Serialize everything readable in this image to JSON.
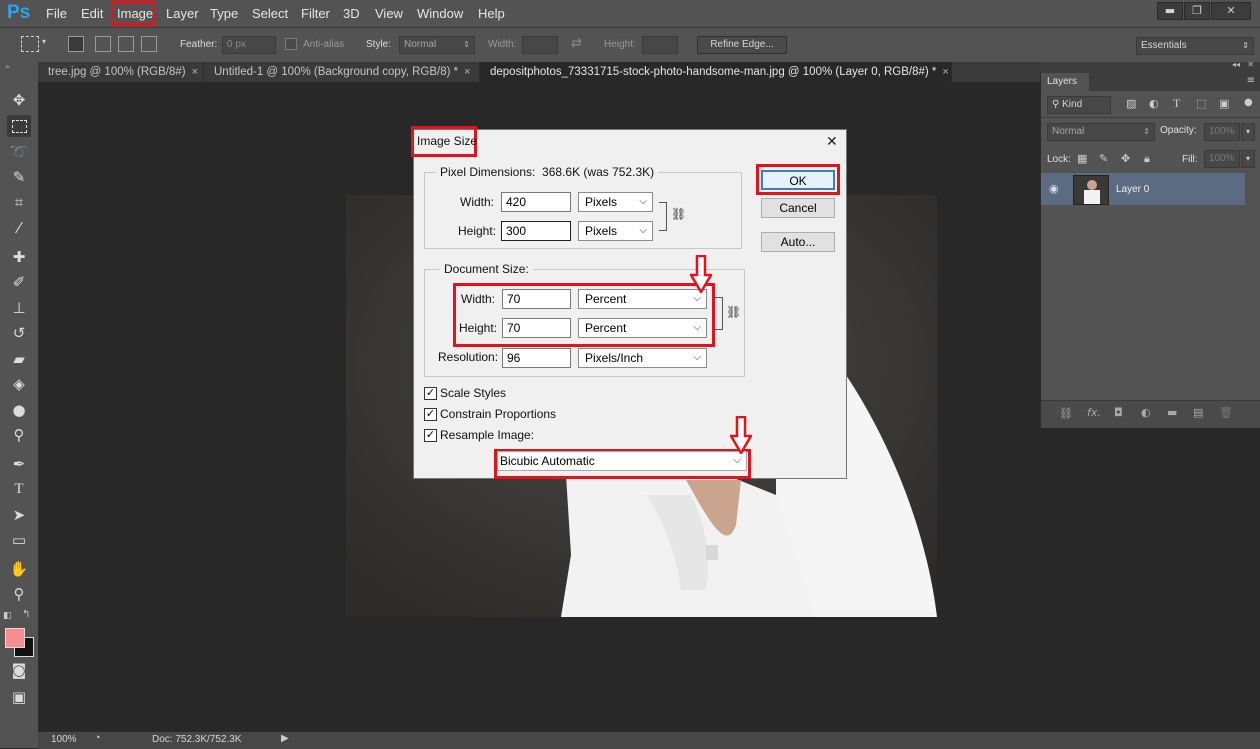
{
  "app": {
    "logo": "Ps"
  },
  "menu": [
    "File",
    "Edit",
    "Image",
    "Layer",
    "Type",
    "Select",
    "Filter",
    "3D",
    "View",
    "Window",
    "Help"
  ],
  "window_controls": {
    "minimize": "▬",
    "restore": "❐",
    "close": "✕"
  },
  "options_bar": {
    "feather_label": "Feather:",
    "feather_value": "0 px",
    "antialias_label": "Anti-alias",
    "style_label": "Style:",
    "style_value": "Normal",
    "width_label": "Width:",
    "height_label": "Height:",
    "refine_edge": "Refine Edge...",
    "workspace": "Essentials"
  },
  "tabs": [
    {
      "label": "tree.jpg @ 100% (RGB/8#)",
      "close": "×"
    },
    {
      "label": "Untitled-1 @ 100% (Background copy, RGB/8) *",
      "close": "×"
    },
    {
      "label": "depositphotos_73331715-stock-photo-handsome-man.jpg @ 100% (Layer 0, RGB/8#) *",
      "close": "×"
    }
  ],
  "layers_panel": {
    "title": "Layers",
    "kind_label": "Kind",
    "blend_mode": "Normal",
    "opacity_label": "Opacity:",
    "opacity_value": "100%",
    "lock_label": "Lock:",
    "fill_label": "Fill:",
    "fill_value": "100%",
    "layer_name": "Layer 0"
  },
  "status_bar": {
    "zoom": "100%",
    "doc": "Doc: 752.3K/752.3K"
  },
  "dialog": {
    "title": "Image Size",
    "close": "✕",
    "pixel_dimensions_label": "Pixel Dimensions:",
    "pixel_dimensions_value": "368.6K (was 752.3K)",
    "px_width_label": "Width:",
    "px_width_value": "420",
    "px_width_unit": "Pixels",
    "px_height_label": "Height:",
    "px_height_value": "300",
    "px_height_unit": "Pixels",
    "document_size_label": "Document Size:",
    "doc_width_label": "Width:",
    "doc_width_value": "70",
    "doc_width_unit": "Percent",
    "doc_height_label": "Height:",
    "doc_height_value": "70",
    "doc_height_unit": "Percent",
    "resolution_label": "Resolution:",
    "resolution_value": "96",
    "resolution_unit": "Pixels/Inch",
    "scale_styles": "Scale Styles",
    "constrain_proportions": "Constrain Proportions",
    "resample_image": "Resample Image:",
    "resample_method": "Bicubic Automatic",
    "ok": "OK",
    "cancel": "Cancel",
    "auto": "Auto..."
  }
}
